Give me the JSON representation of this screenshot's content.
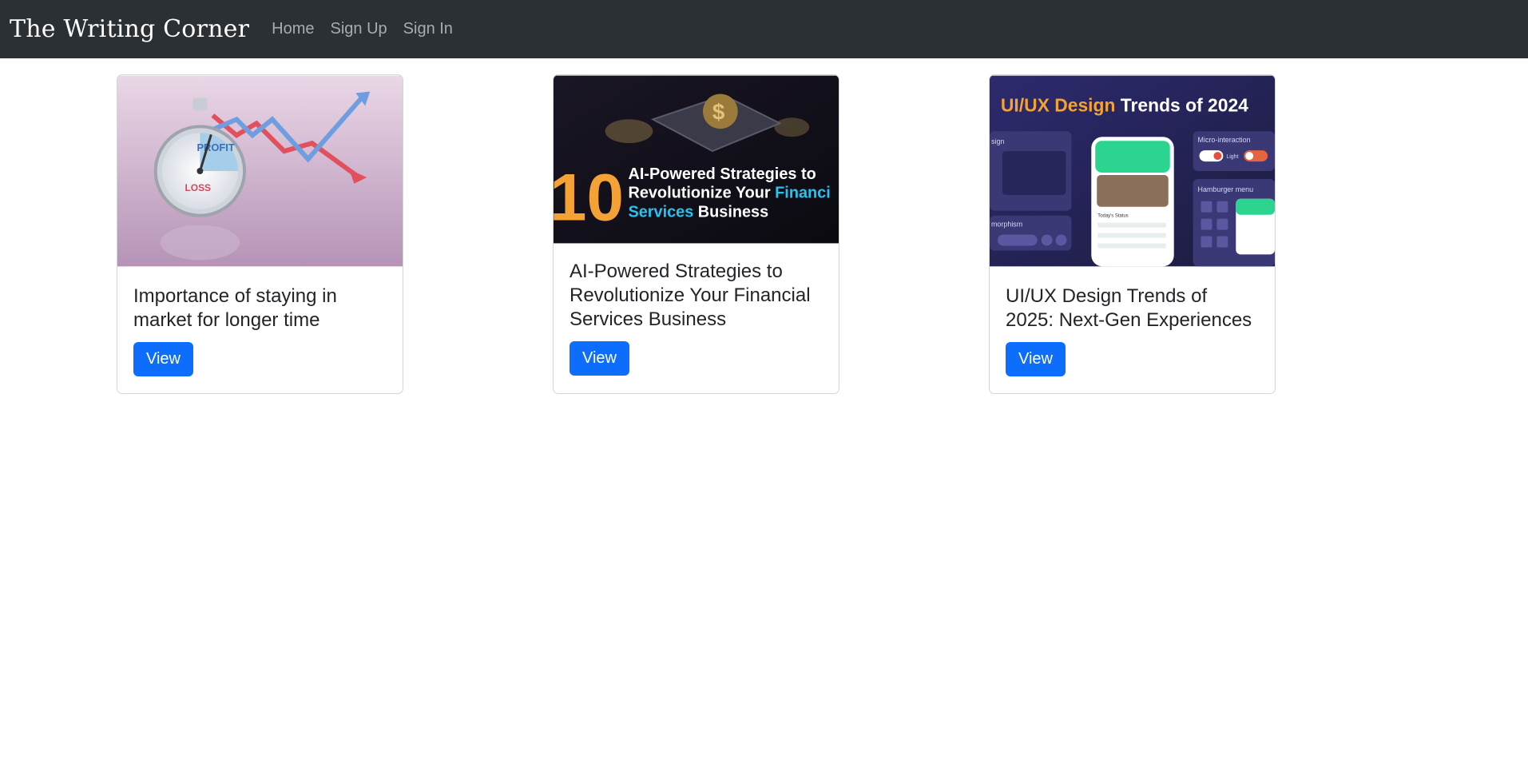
{
  "navbar": {
    "brand": "The Writing Corner",
    "links": [
      "Home",
      "Sign Up",
      "Sign In"
    ]
  },
  "cards": [
    {
      "title": "Importance of staying in market for longer time",
      "button": "View",
      "image": {
        "gauge_top": "PROFIT",
        "gauge_bottom": "LOSS"
      }
    },
    {
      "title": "AI-Powered Strategies to Revolutionize Your Financial Services Business",
      "button": "View",
      "image": {
        "number": "10",
        "line1": "AI-Powered Strategies to",
        "line2_white": "Revolutionize Your ",
        "line2_accent": "Financi",
        "line3_accent": "Services",
        "line3_white": " Business"
      }
    },
    {
      "title": "UI/UX Design Trends of 2025: Next-Gen Experiences",
      "button": "View",
      "image": {
        "heading_accent": "UI/UX Design",
        "heading_white": " Trends of 2024",
        "labels": [
          "sign",
          "Micro-interaction",
          "Light",
          "Hamburger menu",
          "morphism",
          "Today's Status"
        ]
      }
    }
  ],
  "colors": {
    "navbar_bg": "#2b3035",
    "primary": "#0d6efd",
    "accent_orange": "#f4a235",
    "accent_cyan": "#27c3ee"
  }
}
